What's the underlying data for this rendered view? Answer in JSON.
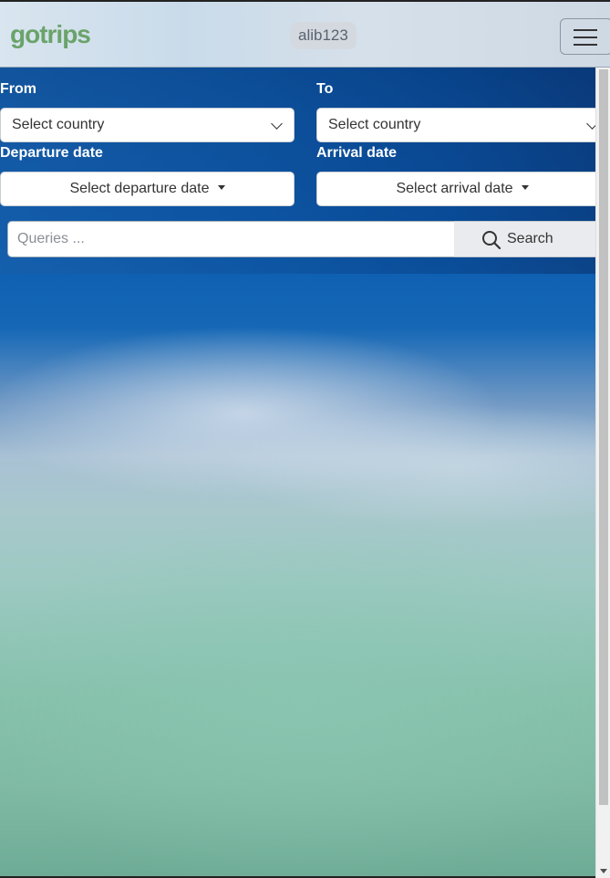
{
  "header": {
    "logo": "gotrips",
    "username": "alib123",
    "menu_icon": "hamburger-menu-icon"
  },
  "form": {
    "from_label": "From",
    "to_label": "To",
    "from_select": "Select country",
    "to_select": "Select country",
    "departure_label": "Departure date",
    "arrival_label": "Arrival date",
    "departure_button": "Select departure date",
    "arrival_button": "Select arrival date"
  },
  "search": {
    "placeholder": "Queries ...",
    "button_label": "Search",
    "icon": "search-icon"
  },
  "colors": {
    "logo": "#6aa36a",
    "header_bg": "#d3e0ec"
  }
}
